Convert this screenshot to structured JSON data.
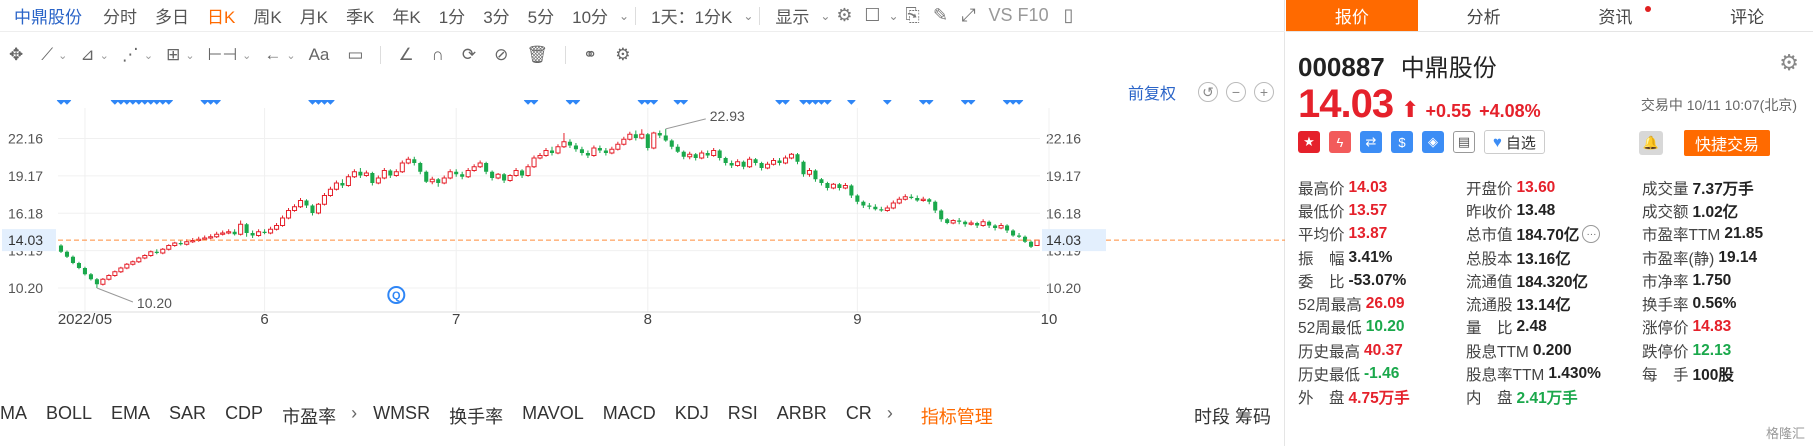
{
  "periodbar": {
    "stock_name": "中鼎股份",
    "periods": [
      "分时",
      "多日",
      "日K",
      "周K",
      "月K",
      "季K",
      "年K",
      "1分",
      "3分",
      "5分",
      "10分"
    ],
    "active": "日K",
    "multi_period": "1天：1分K",
    "display": "显示",
    "vs_f10": "VS F10"
  },
  "adjust_label": "前复权",
  "indicators": [
    "MA",
    "BOLL",
    "EMA",
    "SAR",
    "CDP",
    "市盈率",
    "WMSR",
    "换手率",
    "MAVOL",
    "MACD",
    "KDJ",
    "RSI",
    "ARBR",
    "CR"
  ],
  "indicator_manager": "指标管理",
  "right_tools": "时段 筹码",
  "tabs": [
    {
      "label": "报价",
      "active": true
    },
    {
      "label": "分析",
      "active": false
    },
    {
      "label": "资讯",
      "active": false,
      "dot": true
    },
    {
      "label": "评论",
      "active": false
    }
  ],
  "quote": {
    "code": "000887",
    "name": "中鼎股份",
    "price": "14.03",
    "change": "+0.55",
    "change_pct": "+4.08%",
    "status": "交易中 10/11 10:07(北京)",
    "watch_label": "自选",
    "quick_trade": "快捷交易"
  },
  "stats": [
    [
      {
        "l": "最高价",
        "v": "14.03",
        "c": "red"
      },
      {
        "l": "开盘价",
        "v": "13.60",
        "c": "red"
      },
      {
        "l": "成交量",
        "v": "7.37万手",
        "c": ""
      }
    ],
    [
      {
        "l": "最低价",
        "v": "13.57",
        "c": "red"
      },
      {
        "l": "昨收价",
        "v": "13.48",
        "c": ""
      },
      {
        "l": "成交额",
        "v": "1.02亿",
        "c": ""
      }
    ],
    [
      {
        "l": "平均价",
        "v": "13.87",
        "c": "red"
      },
      {
        "l": "总市值",
        "v": "184.70亿",
        "c": "",
        "more": true
      },
      {
        "l": "市盈率TTM",
        "v": "21.85",
        "c": ""
      }
    ],
    [
      {
        "l": "振　幅",
        "v": "3.41%",
        "c": ""
      },
      {
        "l": "总股本",
        "v": "13.16亿",
        "c": ""
      },
      {
        "l": "市盈率(静)",
        "v": "19.14",
        "c": ""
      }
    ],
    [
      {
        "l": "委　比",
        "v": "-53.07%",
        "c": ""
      },
      {
        "l": "流通值",
        "v": "184.320亿",
        "c": ""
      },
      {
        "l": "市净率",
        "v": "1.750",
        "c": ""
      }
    ],
    [
      {
        "l": "52周最高",
        "v": "26.09",
        "c": "red"
      },
      {
        "l": "流通股",
        "v": "13.14亿",
        "c": ""
      },
      {
        "l": "换手率",
        "v": "0.56%",
        "c": ""
      }
    ],
    [
      {
        "l": "52周最低",
        "v": "10.20",
        "c": "green"
      },
      {
        "l": "量　比",
        "v": "2.48",
        "c": ""
      },
      {
        "l": "涨停价",
        "v": "14.83",
        "c": "red"
      }
    ],
    [
      {
        "l": "历史最高",
        "v": "40.37",
        "c": "red"
      },
      {
        "l": "股息TTM",
        "v": "0.200",
        "c": ""
      },
      {
        "l": "跌停价",
        "v": "12.13",
        "c": "green"
      }
    ],
    [
      {
        "l": "历史最低",
        "v": "-1.46",
        "c": "green"
      },
      {
        "l": "股息率TTM",
        "v": "1.430%",
        "c": ""
      },
      {
        "l": "每　手",
        "v": "100股",
        "c": ""
      }
    ],
    [
      {
        "l": "外　盘",
        "v": "4.75万手",
        "c": "red"
      },
      {
        "l": "内　盘",
        "v": "2.41万手",
        "c": "green"
      }
    ]
  ],
  "watermark": "格隆汇",
  "colors": {
    "up": "#e5212b",
    "down": "#1aa84b",
    "accent": "#ff6a00",
    "link": "#2a64c8",
    "marker": "#2f86f6",
    "price_line": "#ff8c3a"
  },
  "chart_data": {
    "type": "candlestick",
    "y_ticks": [
      "22.16",
      "19.17",
      "16.18",
      "13.19",
      "10.20"
    ],
    "ylim": [
      8.6,
      24.6
    ],
    "x_labels": [
      "2022/05",
      "6",
      "7",
      "8",
      "9",
      "10"
    ],
    "x_label_index": [
      4,
      34,
      66,
      98,
      133,
      165
    ],
    "last_price_label": "14.03",
    "last_price": 14.03,
    "max_label": "22.93",
    "min_label": "10.20",
    "max_index": 101,
    "min_index": 6,
    "marker_label": "Q",
    "marker_index": 56,
    "flag_indices": [
      0,
      1,
      9,
      10,
      11,
      12,
      13,
      14,
      15,
      16,
      17,
      18,
      24,
      25,
      26,
      42,
      43,
      44,
      45,
      78,
      79,
      85,
      86,
      97,
      98,
      99,
      103,
      104,
      120,
      121,
      124,
      125,
      126,
      127,
      128,
      132,
      138,
      144,
      145,
      151,
      152,
      158,
      159,
      160
    ],
    "candles": [
      [
        13.6,
        13.1,
        13.7,
        13.0
      ],
      [
        13.1,
        12.7,
        13.2,
        12.6
      ],
      [
        12.7,
        12.2,
        12.8,
        12.1
      ],
      [
        12.2,
        11.8,
        12.3,
        11.7
      ],
      [
        11.8,
        11.3,
        11.9,
        11.2
      ],
      [
        11.3,
        10.9,
        11.4,
        10.8
      ],
      [
        10.9,
        10.5,
        11.0,
        10.2
      ],
      [
        10.5,
        10.9,
        11.0,
        10.4
      ],
      [
        10.9,
        11.2,
        11.3,
        10.8
      ],
      [
        11.2,
        11.5,
        11.6,
        11.1
      ],
      [
        11.5,
        11.8,
        11.9,
        11.4
      ],
      [
        11.8,
        12.1,
        12.2,
        11.7
      ],
      [
        12.1,
        12.3,
        12.4,
        12.0
      ],
      [
        12.3,
        12.6,
        12.7,
        12.2
      ],
      [
        12.6,
        12.8,
        12.9,
        12.5
      ],
      [
        12.8,
        13.1,
        13.2,
        12.7
      ],
      [
        13.1,
        13.0,
        13.3,
        12.9
      ],
      [
        13.0,
        13.3,
        13.4,
        12.9
      ],
      [
        13.3,
        13.6,
        13.7,
        13.2
      ],
      [
        13.6,
        13.8,
        13.9,
        13.5
      ],
      [
        13.8,
        13.7,
        14.0,
        13.6
      ],
      [
        13.7,
        13.9,
        14.1,
        13.6
      ],
      [
        13.9,
        14.0,
        14.2,
        13.8
      ],
      [
        14.0,
        14.1,
        14.3,
        13.9
      ],
      [
        14.1,
        14.2,
        14.4,
        14.0
      ],
      [
        14.2,
        14.3,
        14.5,
        14.1
      ],
      [
        14.3,
        14.5,
        14.7,
        14.2
      ],
      [
        14.5,
        14.6,
        14.8,
        14.4
      ],
      [
        14.6,
        14.7,
        14.9,
        14.5
      ],
      [
        14.7,
        14.5,
        14.9,
        14.4
      ],
      [
        14.5,
        15.3,
        15.6,
        14.4
      ],
      [
        15.3,
        14.6,
        15.4,
        14.3
      ],
      [
        14.6,
        14.4,
        14.8,
        14.2
      ],
      [
        14.4,
        14.7,
        14.9,
        14.3
      ],
      [
        14.7,
        14.6,
        14.9,
        14.5
      ],
      [
        14.6,
        14.9,
        15.1,
        14.5
      ],
      [
        14.9,
        15.2,
        15.4,
        14.8
      ],
      [
        15.2,
        15.8,
        16.0,
        15.1
      ],
      [
        15.8,
        16.4,
        16.6,
        15.7
      ],
      [
        16.4,
        16.7,
        16.9,
        16.3
      ],
      [
        16.7,
        17.2,
        17.4,
        16.6
      ],
      [
        17.2,
        16.8,
        17.3,
        16.6
      ],
      [
        16.8,
        16.2,
        16.9,
        16.0
      ],
      [
        16.2,
        16.9,
        17.0,
        16.1
      ],
      [
        16.9,
        17.6,
        17.8,
        16.8
      ],
      [
        17.6,
        18.1,
        18.3,
        17.5
      ],
      [
        18.1,
        18.6,
        18.8,
        18.0
      ],
      [
        18.6,
        18.4,
        18.9,
        18.2
      ],
      [
        18.4,
        19.1,
        19.3,
        18.3
      ],
      [
        19.1,
        19.5,
        19.7,
        19.0
      ],
      [
        19.5,
        19.2,
        19.8,
        19.0
      ],
      [
        19.2,
        19.4,
        19.6,
        19.1
      ],
      [
        19.4,
        18.6,
        19.5,
        18.4
      ],
      [
        18.6,
        19.0,
        19.2,
        18.5
      ],
      [
        19.0,
        19.6,
        19.8,
        18.9
      ],
      [
        19.6,
        19.2,
        19.7,
        19.0
      ],
      [
        19.2,
        19.5,
        19.7,
        19.1
      ],
      [
        19.5,
        20.2,
        20.4,
        19.4
      ],
      [
        20.2,
        20.5,
        20.7,
        20.1
      ],
      [
        20.5,
        20.2,
        20.7,
        20.0
      ],
      [
        20.2,
        19.5,
        20.3,
        19.3
      ],
      [
        19.5,
        18.7,
        19.6,
        18.6
      ],
      [
        18.7,
        18.9,
        19.1,
        18.5
      ],
      [
        18.9,
        18.6,
        19.0,
        18.3
      ],
      [
        18.6,
        19.0,
        19.2,
        18.5
      ],
      [
        19.0,
        19.5,
        19.7,
        18.9
      ],
      [
        19.5,
        19.3,
        19.7,
        19.1
      ],
      [
        19.3,
        19.1,
        19.5,
        18.9
      ],
      [
        19.1,
        19.6,
        19.8,
        19.0
      ],
      [
        19.6,
        19.9,
        20.1,
        19.5
      ],
      [
        19.9,
        20.2,
        20.4,
        19.8
      ],
      [
        20.2,
        19.5,
        20.3,
        19.3
      ],
      [
        19.5,
        19.0,
        19.6,
        18.8
      ],
      [
        19.0,
        19.3,
        19.4,
        18.9
      ],
      [
        19.3,
        18.8,
        19.4,
        18.6
      ],
      [
        18.8,
        19.2,
        19.3,
        18.7
      ],
      [
        19.2,
        19.6,
        19.8,
        19.1
      ],
      [
        19.6,
        19.2,
        19.7,
        19.0
      ],
      [
        19.2,
        19.9,
        20.1,
        19.1
      ],
      [
        19.9,
        20.6,
        20.8,
        19.8
      ],
      [
        20.6,
        20.8,
        21.0,
        20.5
      ],
      [
        20.8,
        21.2,
        21.4,
        20.7
      ],
      [
        21.2,
        21.0,
        21.5,
        20.8
      ],
      [
        21.0,
        21.5,
        21.7,
        20.9
      ],
      [
        21.5,
        21.9,
        22.6,
        21.4
      ],
      [
        21.9,
        21.6,
        22.1,
        21.4
      ],
      [
        21.6,
        21.3,
        21.8,
        21.1
      ],
      [
        21.3,
        21.0,
        21.5,
        20.8
      ],
      [
        21.0,
        20.8,
        21.2,
        20.6
      ],
      [
        20.8,
        21.4,
        21.6,
        20.7
      ],
      [
        21.4,
        21.2,
        21.6,
        21.0
      ],
      [
        21.2,
        21.0,
        21.4,
        20.8
      ],
      [
        21.0,
        21.3,
        21.5,
        20.9
      ],
      [
        21.3,
        21.7,
        21.9,
        21.2
      ],
      [
        21.7,
        22.1,
        22.3,
        21.6
      ],
      [
        22.1,
        22.5,
        22.7,
        22.0
      ],
      [
        22.5,
        22.2,
        22.8,
        22.0
      ],
      [
        22.2,
        22.5,
        22.9,
        22.1
      ],
      [
        22.5,
        21.4,
        22.6,
        21.2
      ],
      [
        21.4,
        22.6,
        22.7,
        21.3
      ],
      [
        22.6,
        22.4,
        22.8,
        22.2
      ],
      [
        22.4,
        22.0,
        22.93,
        21.9
      ],
      [
        22.0,
        21.5,
        22.1,
        21.3
      ],
      [
        21.5,
        21.1,
        21.7,
        21.0
      ],
      [
        21.1,
        20.7,
        21.2,
        20.5
      ],
      [
        20.7,
        20.9,
        21.1,
        20.5
      ],
      [
        20.9,
        20.6,
        21.0,
        20.4
      ],
      [
        20.6,
        21.0,
        21.2,
        20.5
      ],
      [
        21.0,
        20.8,
        21.2,
        20.6
      ],
      [
        20.8,
        21.2,
        21.4,
        20.7
      ],
      [
        21.2,
        20.6,
        21.3,
        20.4
      ],
      [
        20.6,
        20.2,
        20.7,
        20.0
      ],
      [
        20.2,
        20.0,
        20.4,
        19.8
      ],
      [
        20.0,
        20.3,
        20.5,
        19.9
      ],
      [
        20.3,
        19.9,
        20.4,
        19.7
      ],
      [
        19.9,
        20.5,
        20.7,
        19.8
      ],
      [
        20.5,
        20.2,
        20.6,
        20.0
      ],
      [
        20.2,
        19.8,
        20.3,
        19.6
      ],
      [
        19.8,
        20.1,
        20.3,
        19.7
      ],
      [
        20.1,
        20.4,
        20.6,
        20.0
      ],
      [
        20.4,
        20.2,
        20.6,
        20.0
      ],
      [
        20.2,
        20.6,
        20.8,
        20.1
      ],
      [
        20.6,
        20.9,
        21.0,
        20.5
      ],
      [
        20.9,
        20.3,
        21.0,
        20.1
      ],
      [
        20.3,
        19.3,
        20.4,
        19.1
      ],
      [
        19.3,
        19.6,
        19.8,
        19.1
      ],
      [
        19.6,
        18.9,
        19.7,
        18.7
      ],
      [
        18.9,
        18.6,
        19.0,
        18.4
      ],
      [
        18.6,
        18.2,
        18.7,
        18.0
      ],
      [
        18.2,
        18.5,
        18.6,
        18.1
      ],
      [
        18.5,
        18.2,
        18.6,
        18.0
      ],
      [
        18.2,
        18.4,
        18.6,
        18.1
      ],
      [
        18.4,
        17.6,
        18.5,
        17.4
      ],
      [
        17.6,
        17.1,
        17.7,
        16.9
      ],
      [
        17.1,
        16.8,
        17.2,
        16.6
      ],
      [
        16.8,
        16.7,
        17.0,
        16.5
      ],
      [
        16.7,
        16.5,
        16.9,
        16.4
      ],
      [
        16.5,
        16.4,
        16.7,
        16.3
      ],
      [
        16.4,
        16.6,
        16.8,
        16.3
      ],
      [
        16.6,
        17.0,
        17.2,
        16.5
      ],
      [
        17.0,
        17.3,
        17.5,
        16.9
      ],
      [
        17.3,
        17.5,
        17.7,
        17.2
      ],
      [
        17.5,
        17.4,
        17.7,
        17.3
      ],
      [
        17.4,
        17.2,
        17.6,
        17.1
      ],
      [
        17.2,
        17.3,
        17.5,
        17.1
      ],
      [
        17.3,
        17.1,
        17.4,
        16.9
      ],
      [
        17.1,
        16.4,
        17.2,
        16.2
      ],
      [
        16.4,
        15.7,
        16.5,
        15.5
      ],
      [
        15.7,
        15.4,
        15.8,
        15.3
      ],
      [
        15.4,
        15.6,
        15.7,
        15.3
      ],
      [
        15.6,
        15.5,
        15.8,
        15.3
      ],
      [
        15.5,
        15.3,
        15.6,
        15.1
      ],
      [
        15.3,
        15.4,
        15.6,
        15.2
      ],
      [
        15.4,
        15.2,
        15.5,
        15.0
      ],
      [
        15.2,
        15.5,
        15.7,
        15.1
      ],
      [
        15.5,
        15.2,
        15.6,
        15.0
      ],
      [
        15.2,
        15.0,
        15.3,
        14.8
      ],
      [
        15.0,
        15.2,
        15.4,
        14.9
      ],
      [
        15.2,
        14.8,
        15.3,
        14.6
      ],
      [
        14.8,
        14.4,
        14.9,
        14.3
      ],
      [
        14.4,
        14.3,
        14.6,
        14.2
      ],
      [
        14.3,
        13.9,
        14.4,
        13.8
      ],
      [
        13.9,
        13.5,
        14.0,
        13.4
      ],
      [
        13.6,
        14.03,
        14.03,
        13.57
      ]
    ]
  }
}
